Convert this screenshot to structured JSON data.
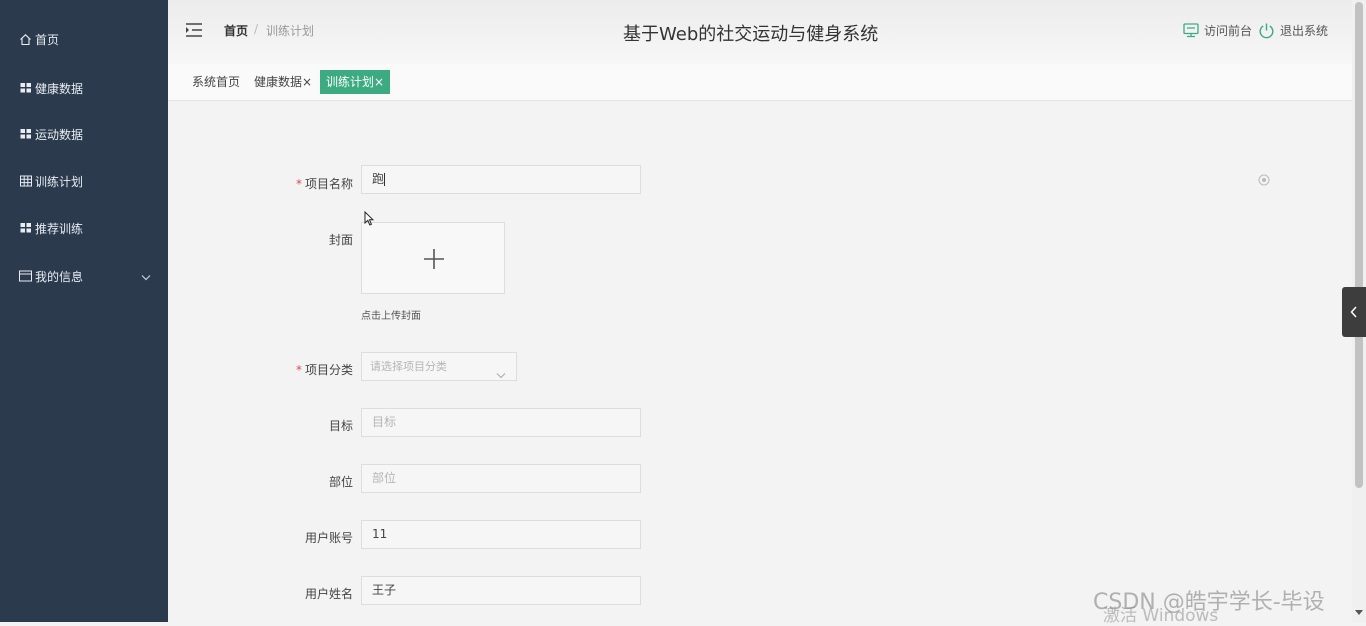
{
  "app_title": "基于Web的社交运动与健身系统",
  "sidebar": {
    "items": [
      {
        "label": "首页",
        "icon": "home-icon"
      },
      {
        "label": "健康数据",
        "icon": "grid-icon"
      },
      {
        "label": "运动数据",
        "icon": "grid-icon"
      },
      {
        "label": "训练计划",
        "icon": "table-icon"
      },
      {
        "label": "推荐训练",
        "icon": "grid-icon"
      },
      {
        "label": "我的信息",
        "icon": "card-icon"
      }
    ]
  },
  "breadcrumb": {
    "home": "首页",
    "separator": "/",
    "current": "训练计划"
  },
  "header_actions": {
    "visit_frontend": "访问前台",
    "logout": "退出系统"
  },
  "tabs": [
    {
      "label": "系统首页",
      "closable": false,
      "active": false
    },
    {
      "label": "健康数据",
      "closable": true,
      "active": false
    },
    {
      "label": "训练计划",
      "closable": true,
      "active": true
    }
  ],
  "tab_close_glyph": "×",
  "form": {
    "project_name": {
      "label": "项目名称",
      "required": true,
      "value": "跑"
    },
    "cover": {
      "label": "封面",
      "hint": "点击上传封面"
    },
    "category": {
      "label": "项目分类",
      "required": true,
      "placeholder": "请选择项目分类"
    },
    "goal": {
      "label": "目标",
      "placeholder": "目标"
    },
    "part": {
      "label": "部位",
      "placeholder": "部位"
    },
    "user_account": {
      "label": "用户账号",
      "value": "11"
    },
    "user_name": {
      "label": "用户姓名",
      "value": "王子"
    }
  },
  "required_mark": "*",
  "watermark": {
    "csdn": "CSDN @皓宇学长-毕设",
    "windows": "激活 Windows"
  },
  "colors": {
    "sidebar_bg": "#2b3a4d",
    "accent": "#3cab82",
    "required": "#e04b4b"
  }
}
